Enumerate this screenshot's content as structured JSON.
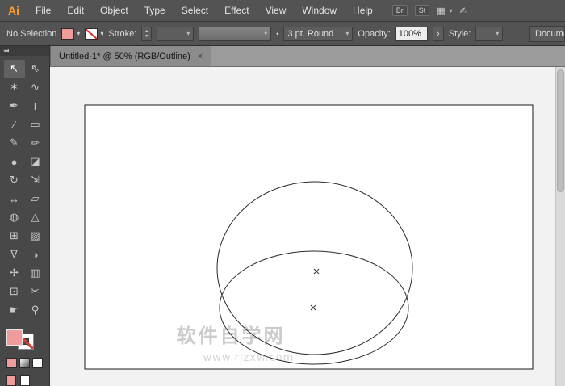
{
  "menubar": {
    "logo": "Ai",
    "items": [
      {
        "label": "File"
      },
      {
        "label": "Edit"
      },
      {
        "label": "Object"
      },
      {
        "label": "Type"
      },
      {
        "label": "Select"
      },
      {
        "label": "Effect"
      },
      {
        "label": "View"
      },
      {
        "label": "Window"
      },
      {
        "label": "Help"
      }
    ],
    "br_button": "Br",
    "st_button": "St"
  },
  "controlbar": {
    "selection_status": "No Selection",
    "stroke_label": "Stroke:",
    "brush_value": "3 pt. Round",
    "opacity_label": "Opacity:",
    "opacity_value": "100%",
    "style_label": "Style:",
    "document_button": "Docume"
  },
  "tabbar": {
    "title": "Untitled-1* @ 50% (RGB/Outline)"
  },
  "tools": [
    {
      "name": "selection",
      "glyph": "↖",
      "selected": true
    },
    {
      "name": "direct-selection",
      "glyph": "⇖"
    },
    {
      "name": "magic-wand",
      "glyph": "✶"
    },
    {
      "name": "lasso",
      "glyph": "∿"
    },
    {
      "name": "pen",
      "glyph": "✒"
    },
    {
      "name": "type",
      "glyph": "T"
    },
    {
      "name": "line-segment",
      "glyph": "∕"
    },
    {
      "name": "rectangle",
      "glyph": "▭"
    },
    {
      "name": "paintbrush",
      "glyph": "✎"
    },
    {
      "name": "pencil",
      "glyph": "✏"
    },
    {
      "name": "blob-brush",
      "glyph": "●"
    },
    {
      "name": "eraser",
      "glyph": "◪"
    },
    {
      "name": "rotate",
      "glyph": "↻"
    },
    {
      "name": "scale",
      "glyph": "⇲"
    },
    {
      "name": "width",
      "glyph": "↔"
    },
    {
      "name": "free-transform",
      "glyph": "▱"
    },
    {
      "name": "shape-builder",
      "glyph": "◍"
    },
    {
      "name": "perspective-grid",
      "glyph": "△"
    },
    {
      "name": "mesh",
      "glyph": "⊞"
    },
    {
      "name": "gradient",
      "glyph": "▨"
    },
    {
      "name": "eyedropper",
      "glyph": "∇"
    },
    {
      "name": "blend",
      "glyph": "◑"
    },
    {
      "name": "symbol-sprayer",
      "glyph": "✢"
    },
    {
      "name": "column-graph",
      "glyph": "▥"
    },
    {
      "name": "artboard",
      "glyph": "⊡"
    },
    {
      "name": "slice",
      "glyph": "✂"
    },
    {
      "name": "hand",
      "glyph": "☛"
    },
    {
      "name": "zoom",
      "glyph": "⚲"
    }
  ],
  "canvas": {
    "watermark_title": "软件自学网",
    "watermark_url": "www.rjzxw.com"
  },
  "icons": {
    "chevron_down": "▾",
    "grid": "▦",
    "workspace": "✍",
    "collapse": "◂◂",
    "close": "×",
    "spin_up": "▴",
    "spin_down": "▾",
    "bullet": "•",
    "expand_arrow": "›"
  },
  "colors": {
    "fill_pink": "#f19c9c",
    "slash_red": "#d83a34",
    "chrome_gray": "#535353",
    "canvas_gray": "#f2f2f2"
  }
}
